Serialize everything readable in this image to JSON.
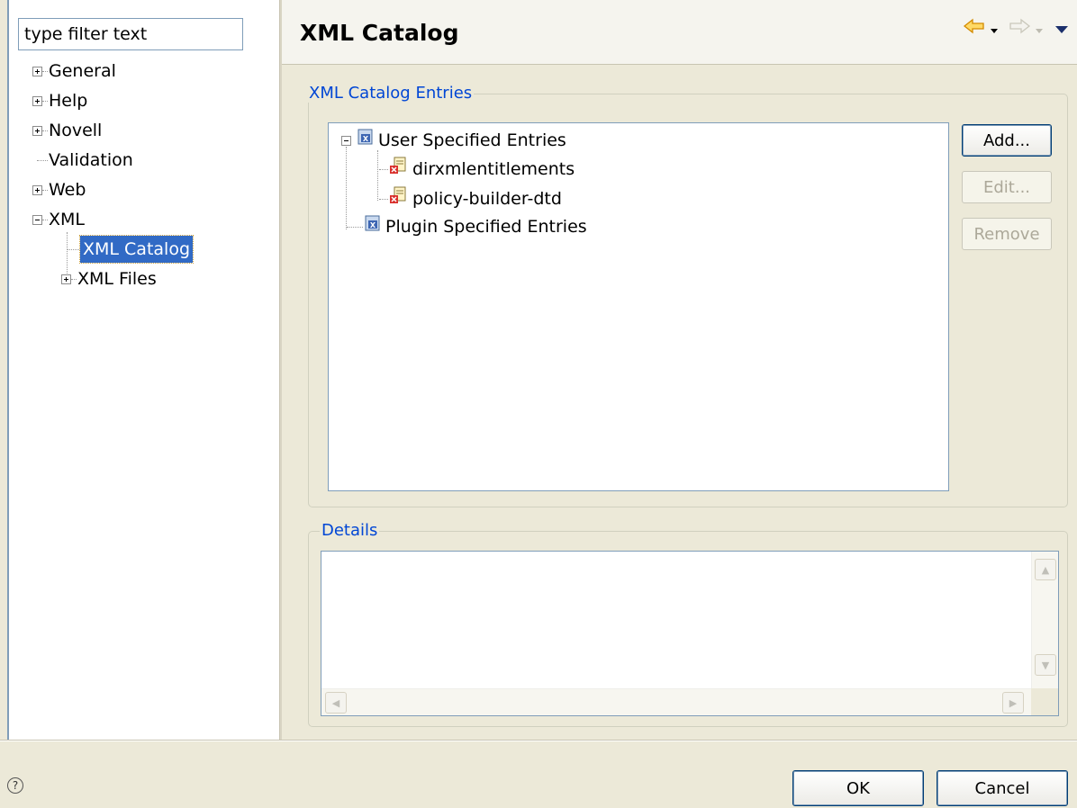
{
  "filter": {
    "value": "type filter text"
  },
  "tree": {
    "items": [
      {
        "label": "General",
        "expander": "plus"
      },
      {
        "label": "Help",
        "expander": "plus"
      },
      {
        "label": "Novell",
        "expander": "plus"
      },
      {
        "label": "Validation",
        "expander": "none"
      },
      {
        "label": "Web",
        "expander": "plus"
      },
      {
        "label": "XML",
        "expander": "minus"
      },
      {
        "label": "XML Catalog",
        "expander": "none",
        "selected": true
      },
      {
        "label": "XML Files",
        "expander": "plus"
      }
    ]
  },
  "header": {
    "title": "XML Catalog",
    "nav": {
      "back_icon": "back-arrow-icon",
      "forward_icon": "forward-arrow-icon",
      "menu_icon": "view-menu-icon"
    }
  },
  "entries_group": {
    "label": "XML Catalog Entries",
    "tree": [
      {
        "label": "User Specified Entries",
        "icon": "catalog-icon"
      },
      {
        "label": "dirxmlentitlements",
        "icon": "catalog-entry-icon"
      },
      {
        "label": "policy-builder-dtd",
        "icon": "catalog-entry-icon"
      },
      {
        "label": "Plugin Specified Entries",
        "icon": "catalog-icon"
      }
    ],
    "buttons": {
      "add": "Add...",
      "edit": "Edit...",
      "remove": "Remove"
    }
  },
  "details_group": {
    "label": "Details",
    "value": ""
  },
  "footer": {
    "ok": "OK",
    "cancel": "Cancel",
    "help_icon": "help-icon"
  },
  "colors": {
    "selection": "#316ac5",
    "group_label": "#0046d5",
    "accent_arrow": "#e6a800"
  }
}
